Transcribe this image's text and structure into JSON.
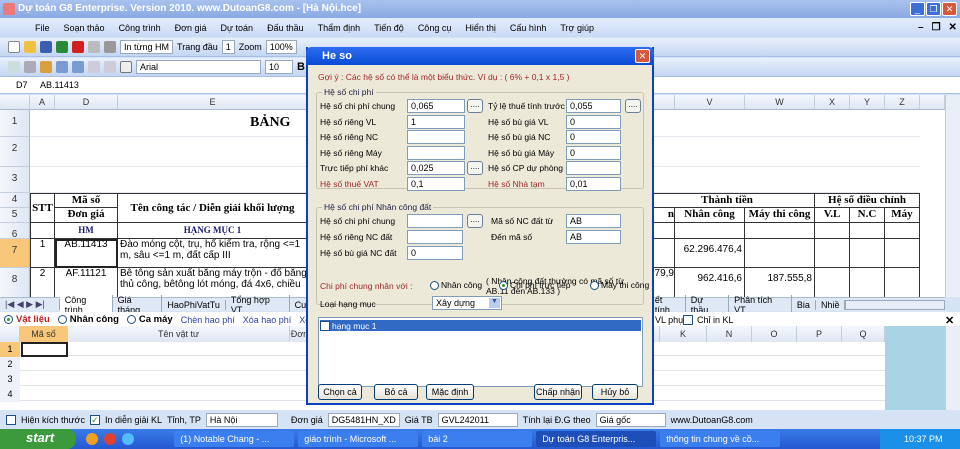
{
  "window": {
    "title": "Dự toán G8 Enterprise. Version 2010.  www.DutoanG8.com  - [Hà Nội.hce]",
    "minimize": "_",
    "restore": "❐",
    "close": "✕"
  },
  "menu": [
    "File",
    "Soạn thảo",
    "Công trình",
    "Đơn giá",
    "Dự toán",
    "Đấu thầu",
    "Thẩm định",
    "Tiến độ",
    "Công cụ",
    "Hiển thị",
    "Cấu hình",
    "Trợ giúp"
  ],
  "mdi_controls": {
    "minimize": "–",
    "restore": "❐",
    "close": "✕"
  },
  "toolbar1": {
    "print_mode": "In từng HM",
    "first_page_label": "Trang đầu",
    "first_page": "1",
    "zoom_label": "Zoom",
    "zoom": "100%"
  },
  "toolbar2": {
    "font": "Arial",
    "size": "10",
    "bold": "B"
  },
  "formula": {
    "cell_ref": "D7",
    "value": "AB.11413"
  },
  "sheet": {
    "columns_left": [
      "A",
      "D",
      "E"
    ],
    "columns_right": [
      "V",
      "W",
      "X",
      "Y",
      "Z"
    ],
    "rows": [
      "1",
      "2",
      "3",
      "4",
      "5",
      "6",
      "7",
      "8"
    ],
    "title_partial": "BẢNG",
    "hdr_stt": "STT",
    "hdr_maso": "Mã số",
    "hdr_dongia": "Đơn giá",
    "hdr_ten": "Tên công tác / Diễn giải khối lượng",
    "hdr_hm": "HM",
    "hdr_hangmuc": "HẠNG MỤC 1",
    "hdr_thanhtien": "Thành tiền",
    "hdr_partial": "n",
    "hdr_nhancong": "Nhân công",
    "hdr_maythicong": "Máy thi công",
    "hdr_hesodc": "Hệ số điều chỉnh",
    "hdr_vl": "V.L",
    "hdr_nc": "N.C",
    "hdr_may": "Máy",
    "data": [
      {
        "stt": "1",
        "ma": "AB.11413",
        "ten": "Đào móng cột, trụ, hố kiểm tra, rộng <=1 m, sâu <=1 m, đất cấp III",
        "partial": "",
        "nhancong": "62.296.476,4",
        "may": ""
      },
      {
        "stt": "2",
        "ma": "AF.11121",
        "ten": "Bê tông sản xuất bằng máy trộn - đổ bằng thủ công, bêtông lót móng, đá 4x6, chiều",
        "partial": "79,9",
        "nhancong": "962.416,6",
        "may": "187.555,8"
      }
    ]
  },
  "sheet_tabs_left": [
    "Công trình",
    "Giá tháng",
    "HaoPhiVatTu",
    "Tổng hợp VT",
    "Cước"
  ],
  "sheet_tabs_right": [
    "ết tính",
    "Dự thầu",
    "Phân tích VT",
    "Bia",
    "Nhiề"
  ],
  "lower": {
    "radios": [
      {
        "label": "Vật liệu",
        "checked": true
      },
      {
        "label": "Nhân công",
        "checked": false
      },
      {
        "label": "Ca máy",
        "checked": false
      }
    ],
    "links": [
      "Chèn hao phí",
      "Xóa hao phí",
      "Xóa"
    ],
    "right_opts": {
      "vl_phu": "VL phụ",
      "chi_in_kl": "Chỉ in KL"
    },
    "close": "✕",
    "columns_left": [
      "Mã số",
      "Tên vật tư",
      "Đơn"
    ],
    "columns_right": [
      "K",
      "N",
      "O",
      "P",
      "Q"
    ],
    "rows": [
      "1",
      "2",
      "3",
      "4"
    ]
  },
  "statusbar": {
    "hien_kich_thuoc": "Hiện kích thước",
    "in_dien_giai": "In diễn giải KL",
    "tinh_label": "Tỉnh, TP",
    "tinh": "Hà Nội",
    "dongia_label": "Đơn giá",
    "dongia": "DG5481HN_XD",
    "giatb_label": "Giá TB",
    "giatb": "GVL242011",
    "tinhlai_label": "Tính lại Đ.G theo",
    "tinhlai": "Giá gốc",
    "website": "www.DutoanG8.com"
  },
  "taskbar": {
    "start": "start",
    "tasks": [
      "(1) Notable Chang - ...",
      "giáo trình - Microsoft ...",
      "bài 2",
      "Dự toán G8 Enterpris...",
      "thông tin chung về cồ..."
    ],
    "time": "10:37 PM"
  },
  "dialog": {
    "title": "He so",
    "close": "✕",
    "hint": "Gợi ý : Các hệ số có thể là một biểu thức. Ví dụ : ( 6% + 0,1 x 1,5 )",
    "group1": "Hệ số chi phí",
    "left_fields": [
      {
        "label": "Hệ số chi phí chung",
        "value": "0,065",
        "dots": true
      },
      {
        "label": "Hệ số riêng VL",
        "value": "1"
      },
      {
        "label": "Hệ số riêng NC",
        "value": ""
      },
      {
        "label": "Hệ số riêng Máy",
        "value": ""
      },
      {
        "label": "Trực tiếp phí khác",
        "value": "0,025",
        "dots": true
      },
      {
        "label": "Hệ số thuế VAT",
        "value": "0,1",
        "red": true
      }
    ],
    "right_fields": [
      {
        "label": "Tỷ lệ thuế tính trước",
        "value": "0,055",
        "dots": true
      },
      {
        "label": "Hệ số bù giá VL",
        "value": "0"
      },
      {
        "label": "Hệ số bù giá NC",
        "value": "0"
      },
      {
        "label": "Hệ số bù giá Máy",
        "value": "0"
      },
      {
        "label": "Hệ số CP dự phòng",
        "value": ""
      },
      {
        "label": "Hệ số Nhà tạm",
        "value": "0,01",
        "red": true
      }
    ],
    "dots_label": "....",
    "group2": "Hệ số chi phí Nhân công đất",
    "nc_left": [
      {
        "label": "Hệ số chi phí chung",
        "value": "",
        "dots": true
      },
      {
        "label": "Hệ số riêng NC đất",
        "value": ""
      },
      {
        "label": "Hệ số bù giá NC đất",
        "value": "0"
      }
    ],
    "nc_right": [
      {
        "label": "Mã số NC đất từ",
        "value": "AB"
      },
      {
        "label": "Đến mã số",
        "value": "AB"
      }
    ],
    "nc_note": "( Nhân công đất thường có mã số từ AB.11 đến AB.133 )",
    "multiply_label": "Chi phí chung nhân với :",
    "multiply_options": [
      {
        "label": "Nhân công",
        "checked": false
      },
      {
        "label": "Chi phí trực tiếp",
        "checked": true
      },
      {
        "label": "Máy thi công",
        "checked": false
      }
    ],
    "loai_label": "Loại hạng mục",
    "loai_value": "Xây dựng",
    "items": [
      {
        "label": "hạng mục 1",
        "checked": false,
        "selected": true
      }
    ],
    "buttons": {
      "select_all": "Chọn cả",
      "deselect_all": "Bỏ cả",
      "default": "Mặc định",
      "ok": "Chấp nhận",
      "cancel": "Hủy bỏ"
    }
  },
  "colors": {
    "title_blue": "#0a4bd6",
    "selection": "#316ac5",
    "red_label": "#a0282c",
    "header_navy": "#1a1a6e"
  }
}
